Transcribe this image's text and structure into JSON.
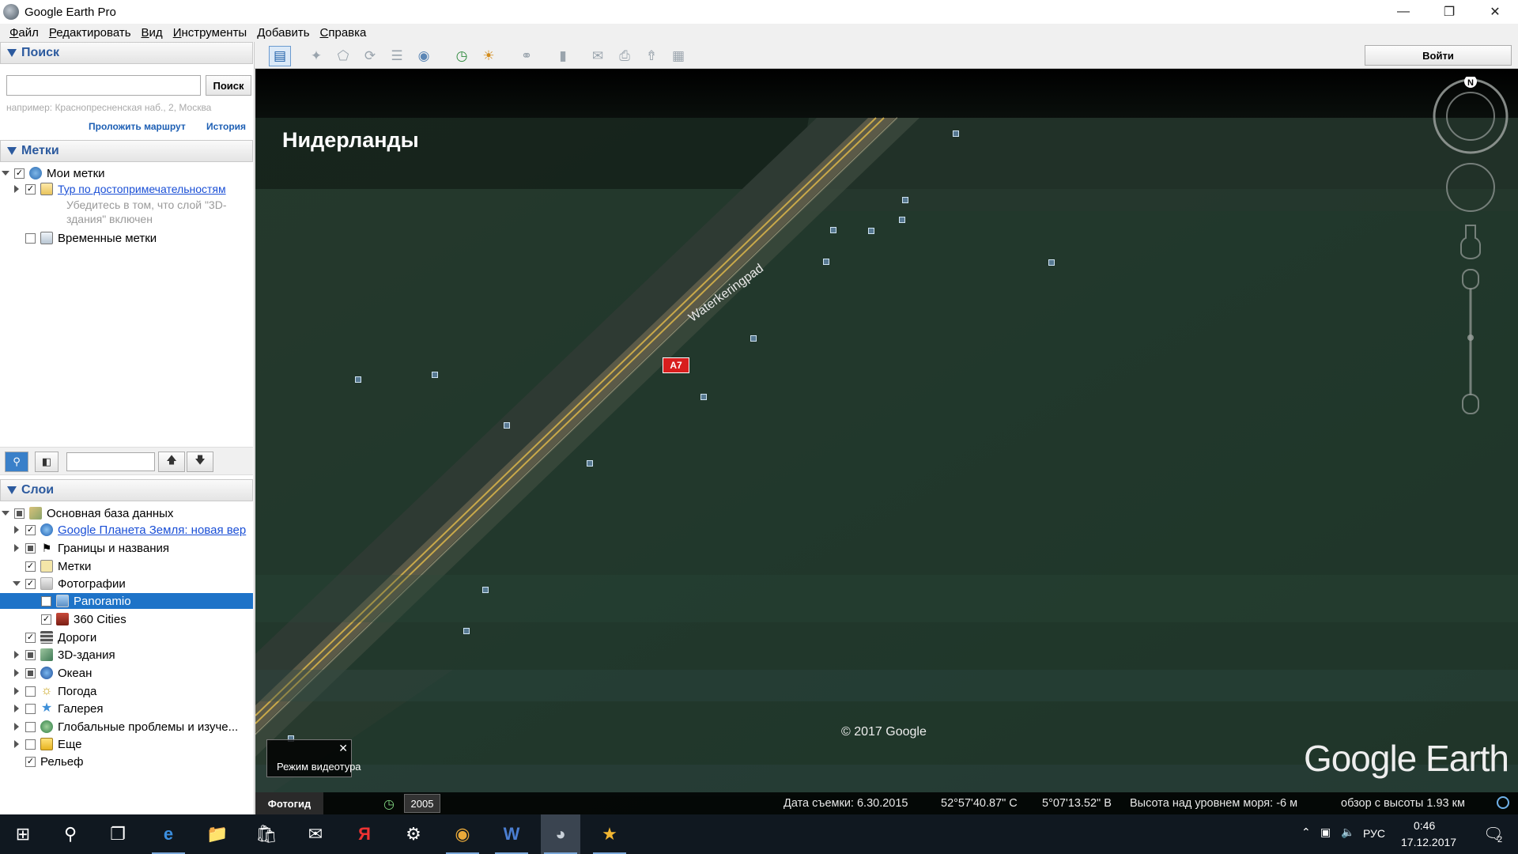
{
  "window": {
    "title": "Google Earth Pro"
  },
  "menu": [
    "Файл",
    "Редактировать",
    "Вид",
    "Инструменты",
    "Добавить",
    "Справка"
  ],
  "search": {
    "header": "Поиск",
    "button": "Поиск",
    "hint": "например: Краснопресненская наб., 2, Москва",
    "route_link": "Проложить маршрут",
    "history_link": "История"
  },
  "places": {
    "header": "Метки",
    "my_places": "Мои метки",
    "tour_link": "Тур по достопримечательностям",
    "tour_note_1": "Убедитесь в том, что слой \"3D-",
    "tour_note_2": "здания\" включен",
    "temp_places": "Временные метки"
  },
  "layers": {
    "header": "Слои",
    "items": [
      "Основная база данных",
      "Google Планета Земля: новая вер",
      "Границы и названия",
      "Метки",
      "Фотографии",
      "Panoramio",
      "360 Cities",
      "Дороги",
      "3D-здания",
      "Океан",
      "Погода",
      "Галерея",
      "Глобальные проблемы и изуче...",
      "Еще",
      "Рельеф"
    ]
  },
  "toolbar": {
    "login": "Войти"
  },
  "map": {
    "title": "Нидерланды",
    "road_label": "Waterkeringpad",
    "road_shield": "A7",
    "copyright": "© 2017 Google",
    "logo": "Google Earth",
    "compass_n": "N",
    "tour_mode": "Режим видеотура"
  },
  "status": {
    "photo_tab": "Фотогид",
    "year": "2005",
    "date": "Дата съемки: 6.30.2015",
    "lat": "52°57'40.87\" С",
    "lon": "5°07'13.52\" В",
    "elevation": "Высота над уровнем моря:   -6 м",
    "eye": "обзор с высоты   1.93 км"
  },
  "taskbar": {
    "lang": "РУС",
    "time": "0:46",
    "date": "17.12.2017",
    "notifications": "2"
  },
  "colors": {
    "accent": "#1e73c8",
    "link": "#1a4fd6",
    "header": "#2c5a9e",
    "shield": "#d81e1e"
  }
}
